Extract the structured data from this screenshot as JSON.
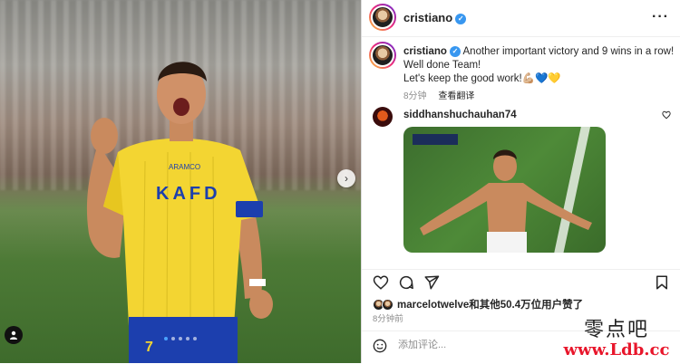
{
  "post": {
    "username": "cristiano",
    "verified_symbol": "✓",
    "more_symbol": "···",
    "carousel_count": 5,
    "carousel_active": 0,
    "nav_arrow": "›"
  },
  "caption": {
    "username": "cristiano",
    "text_line1": "Another important victory and 9 wins in a row!",
    "text_line2": "Well done Team!",
    "text_line3": "Let's keep the good work!💪🏼💙💛",
    "time": "8分钟",
    "translate": "查看翻译"
  },
  "comment": {
    "username": "siddhanshuchauhan74"
  },
  "shirt": {
    "sponsor": "KAFD",
    "badge_text": "ARAMCO",
    "number": "7"
  },
  "likes": {
    "text": "marcelotwelve和其他50.4万位用户赞了",
    "time": "8分钟前"
  },
  "add_comment": {
    "placeholder": "添加评论..."
  },
  "watermark": {
    "cn": "零点吧",
    "url": "www.Ldb.cc"
  },
  "colors": {
    "verified": "#3897f0",
    "jersey": "#f3d532",
    "watermark_url": "#e8162b"
  },
  "icons": [
    "heart-icon",
    "comment-icon",
    "share-icon",
    "bookmark-icon",
    "emoji-icon",
    "tag-user-icon",
    "chevron-right-icon",
    "more-icon",
    "verified-icon"
  ]
}
